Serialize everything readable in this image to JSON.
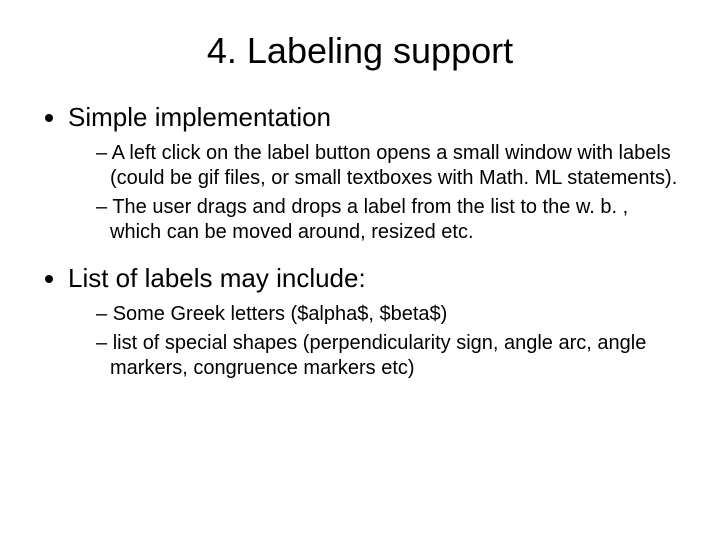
{
  "title": "4. Labeling support",
  "bullets": [
    {
      "text": "Simple implementation",
      "sub": [
        "A left click on the label button opens a small window with labels (could be gif files, or small textboxes with Math. ML statements).",
        "The user drags and drops a label from the list to the w. b. , which can be moved around, resized etc."
      ]
    },
    {
      "text": "List of labels may include:",
      "sub": [
        "Some Greek letters ($alpha$, $beta$)",
        "list of special shapes (perpendicularity sign, angle arc, angle markers, congruence markers etc)"
      ]
    }
  ]
}
